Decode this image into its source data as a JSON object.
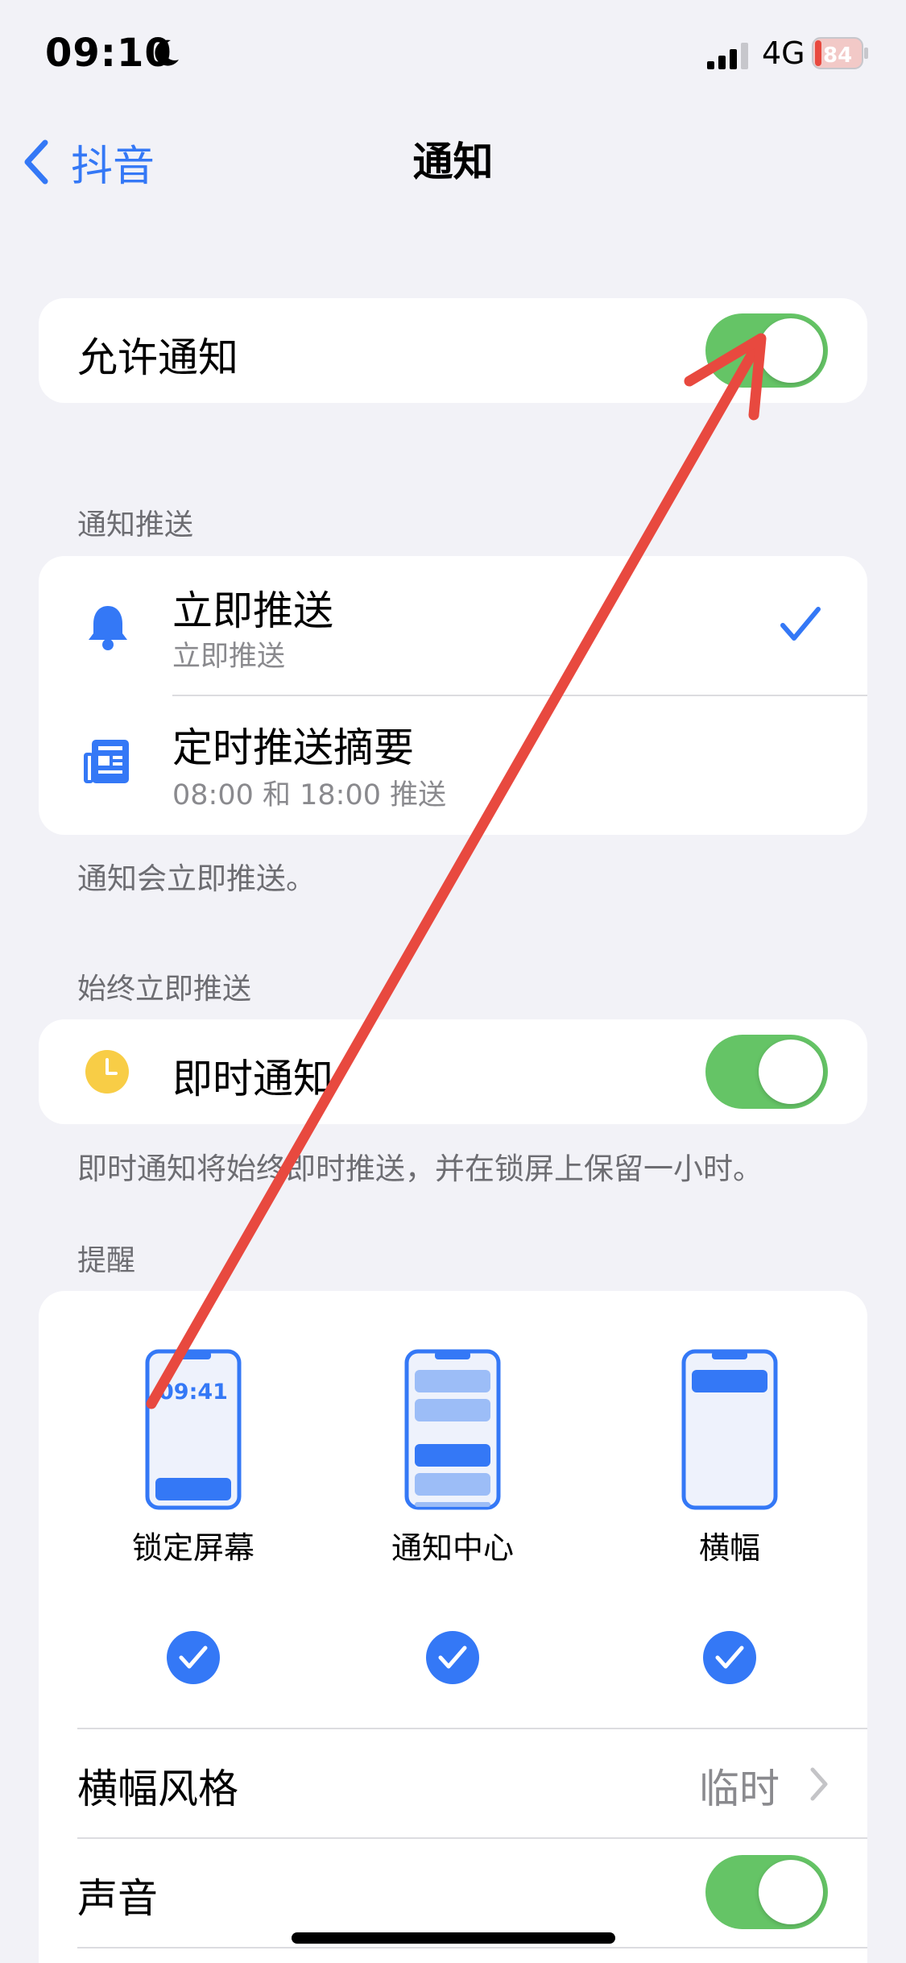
{
  "status_bar": {
    "time": "09:10",
    "network": "4G",
    "battery": "84"
  },
  "nav": {
    "back_label": "抖音",
    "title": "通知"
  },
  "allow_notifications": {
    "label": "允许通知",
    "enabled": true
  },
  "delivery": {
    "header": "通知推送",
    "immediate_title": "立即推送",
    "immediate_subtitle": "立即推送",
    "summary_title": "定时推送摘要",
    "summary_subtitle": "08:00 和 18:00 推送",
    "footer": "通知会立即推送。"
  },
  "always_immediate": {
    "header": "始终立即推送",
    "label": "即时通知",
    "enabled": true,
    "footer": "即时通知将始终即时推送，并在锁屏上保留一小时。"
  },
  "alerts": {
    "header": "提醒",
    "lock_screen_time": "09:41",
    "lock_screen": "锁定屏幕",
    "notification_center": "通知中心",
    "banners": "横幅"
  },
  "banner_style": {
    "label": "横幅风格",
    "value": "临时"
  },
  "sounds": {
    "label": "声音",
    "enabled": true
  },
  "colors": {
    "accent": "#3478f6",
    "toggle_on": "#65c466",
    "annotation_arrow": "#e8493f"
  }
}
